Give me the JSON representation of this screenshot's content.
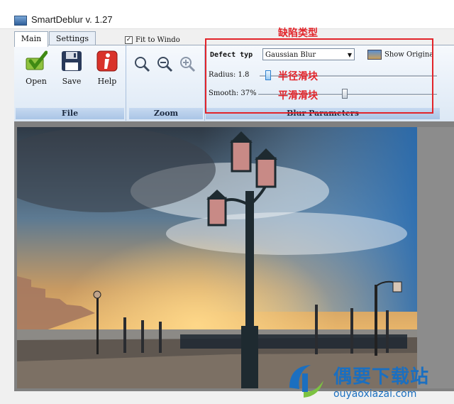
{
  "window": {
    "title": "SmartDeblur v. 1.27"
  },
  "tabs": [
    {
      "label": "Main",
      "active": true
    },
    {
      "label": "Settings",
      "active": false
    }
  ],
  "ribbon": {
    "file_group": {
      "caption": "File",
      "buttons": [
        {
          "label": "Open",
          "icon": "open-check-icon"
        },
        {
          "label": "Save",
          "icon": "floppy-disk-icon"
        },
        {
          "label": "Help",
          "icon": "info-icon"
        }
      ]
    },
    "zoom_group": {
      "caption": "Zoom",
      "icons": [
        "zoom-fit-icon",
        "zoom-out-icon",
        "zoom-in-icon"
      ],
      "fit_to_window": {
        "label": "Fit to Windo",
        "checked": true
      }
    },
    "blur_group": {
      "caption": "Blur Parameters",
      "defect_type_label": "Defect typ",
      "defect_type_value": "Gaussian Blur",
      "show_original_label": "Show Origina",
      "radius": {
        "label": "Radius:",
        "value": "1.8",
        "level": 0.03
      },
      "smoothness": {
        "label": "Smooth:",
        "value": "37%",
        "level": 0.37
      }
    }
  },
  "annotations": {
    "defect_type": "缺陷类型",
    "radius_slider": "半径滑块",
    "smooth_slider": "平滑滑块"
  },
  "watermark": {
    "name": "偶要下载站",
    "url": "ouyaoxiazai.com"
  },
  "colors": {
    "annotation_red": "#e2242a",
    "ribbon_blue": "#dce8f5",
    "watermark_blue": "#1b6fc0"
  }
}
